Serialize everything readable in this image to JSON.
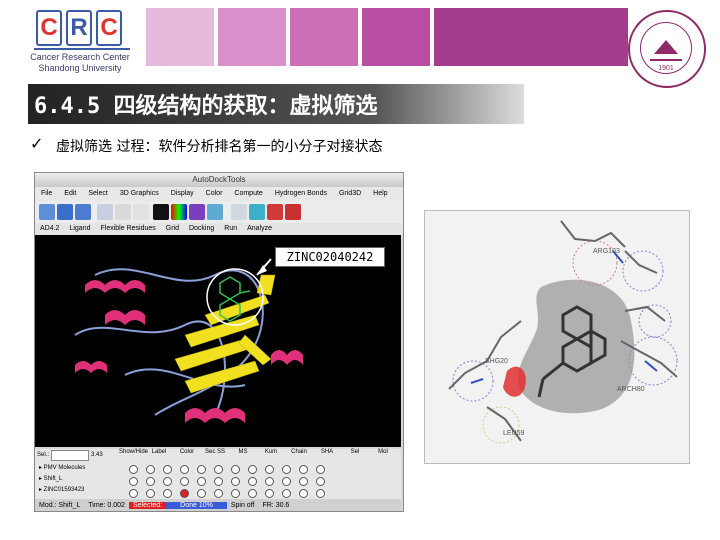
{
  "header": {
    "logo_letters": [
      "C",
      "R",
      "C"
    ],
    "logo_line1": "Cancer Research Center",
    "logo_line2": "Shandong University",
    "band_colors": [
      "#e7b9dc",
      "#d98fcb",
      "#cc6fb8",
      "#b94ea3",
      "#a53d8e"
    ],
    "seal_text": "SHANDONG UNIVERSITY",
    "seal_year": "1901"
  },
  "slide": {
    "title": "6.4.5 四级结构的获取：虚拟筛选",
    "bullet": "ü",
    "subtitle": "虚拟筛选 过程：软件分析排名第一的小分子对接状态"
  },
  "app": {
    "window_title": "AutoDockTools",
    "menus": [
      "File",
      "Edit",
      "Select",
      "3D Graphics",
      "Display",
      "Color",
      "Compute",
      "Hydrogen Bonds",
      "Grid3D",
      "Help"
    ],
    "menus2": [
      "AD4.2",
      "Ligand",
      "Flexible Residues",
      "Grid",
      "Docking",
      "Run",
      "Analyze"
    ],
    "callout_label": "ZINC02040242",
    "panel": {
      "sel_label": "Sel.:",
      "sel_value": "3.43",
      "columns": [
        "Show/Hide",
        "Label",
        "Color",
        "Sec SS",
        "MS",
        "Kum",
        "Chain",
        "SHA",
        "Sel",
        "Mol"
      ],
      "tree": [
        "PMV Molecules",
        "Shift_L",
        "ZINC01593423"
      ]
    },
    "status": {
      "mod": "Mod.: Shift_L",
      "time": "Time: 0.002",
      "selected": "Selected:",
      "done": "Done 10%",
      "spin": "Spin off",
      "fr": "FR: 30.6"
    }
  },
  "docking_image": {
    "labels": [
      "ARG103",
      "SHG20",
      "ARCH80",
      "LEU59"
    ]
  },
  "colors": {
    "accent": "#a53d8e",
    "title_bg": "#333333",
    "helix": "#e0307a",
    "sheet": "#f0e020",
    "ligand": "#30c050"
  }
}
